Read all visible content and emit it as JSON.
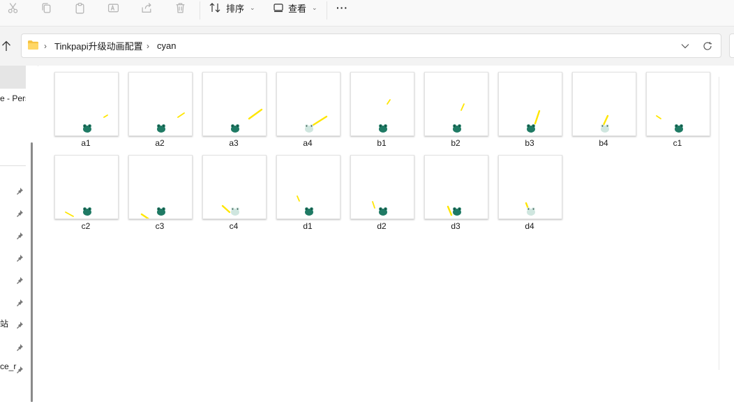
{
  "toolbar": {
    "sort_label": "排序",
    "view_label": "查看",
    "more_label": "···"
  },
  "address_bar": {
    "crumbs": [
      "Tinkpapi升级动画配置",
      "cyan"
    ],
    "separator": "›"
  },
  "sidebar": {
    "items": [
      "e - Pers",
      "站",
      "ce_r"
    ]
  },
  "files": [
    {
      "name": "a1",
      "direction": "a",
      "level": 1
    },
    {
      "name": "a2",
      "direction": "a",
      "level": 2
    },
    {
      "name": "a3",
      "direction": "a",
      "level": 3
    },
    {
      "name": "a4",
      "direction": "a",
      "level": 4
    },
    {
      "name": "b1",
      "direction": "b",
      "level": 1
    },
    {
      "name": "b2",
      "direction": "b",
      "level": 2
    },
    {
      "name": "b3",
      "direction": "b",
      "level": 3
    },
    {
      "name": "b4",
      "direction": "b",
      "level": 4
    },
    {
      "name": "c1",
      "direction": "c",
      "level": 1
    },
    {
      "name": "c2",
      "direction": "c",
      "level": 2
    },
    {
      "name": "c3",
      "direction": "c",
      "level": 3
    },
    {
      "name": "c4",
      "direction": "c",
      "level": 4
    },
    {
      "name": "d1",
      "direction": "d",
      "level": 1
    },
    {
      "name": "d2",
      "direction": "d",
      "level": 2
    },
    {
      "name": "d3",
      "direction": "d",
      "level": 3
    },
    {
      "name": "d4",
      "direction": "d",
      "level": 4
    }
  ],
  "colors": {
    "frog": "#1f7a64",
    "frog_pale": "#cfe6df",
    "streak": "#ffe600",
    "folder": "#f6c342"
  },
  "icons": [
    "cut-icon",
    "copy-icon",
    "paste-icon",
    "rename-icon",
    "share-icon",
    "delete-icon",
    "sort-icon",
    "view-icon",
    "more-icon",
    "up-arrow-icon",
    "folder-icon",
    "chevron-down-icon",
    "refresh-icon",
    "pin-icon"
  ]
}
